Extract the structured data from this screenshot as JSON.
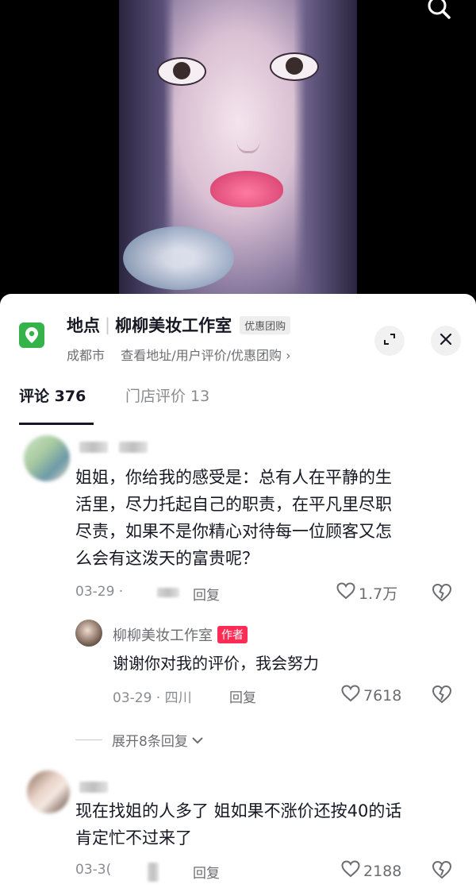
{
  "location": {
    "prefix": "地点",
    "store_name": "柳柳美妆工作室",
    "tag": "优惠团购",
    "city": "成都市",
    "links": "查看地址/用户评价/优惠团购",
    "chevron": "›"
  },
  "tabs": {
    "comments_label": "评论",
    "comments_count": "376",
    "store_reviews": "门店评价 13"
  },
  "comments": [
    {
      "lines": [
        "姐姐，你给我的感受是：总有人在平静的生",
        "活里，尽力托起自己的职责，在平凡里尽职",
        "尽责，如果不是你精心对待每一位顾客又怎",
        "么会有这泼天的富贵呢？"
      ],
      "date": "03-29 ·",
      "reply": "回复",
      "likes": "1.7万",
      "reply_item": {
        "author": "柳柳美妆工作室",
        "badge": "作者",
        "text": "谢谢你对我的评价，我会努力",
        "date": "03-29 · 四川",
        "reply": "回复",
        "likes": "7618"
      },
      "expand": "展开8条回复"
    },
    {
      "lines": [
        "现在找姐的人多了 姐如果不涨价还按40的话",
        "肯定忙不过来了"
      ],
      "date": "03-3(",
      "reply": "回复",
      "likes": "2188"
    }
  ],
  "icons": {
    "search": "search-icon",
    "location": "location-pin-icon",
    "expand": "expand-icon",
    "close": "close-icon",
    "like": "heart-icon",
    "dislike": "broken-heart-icon"
  }
}
